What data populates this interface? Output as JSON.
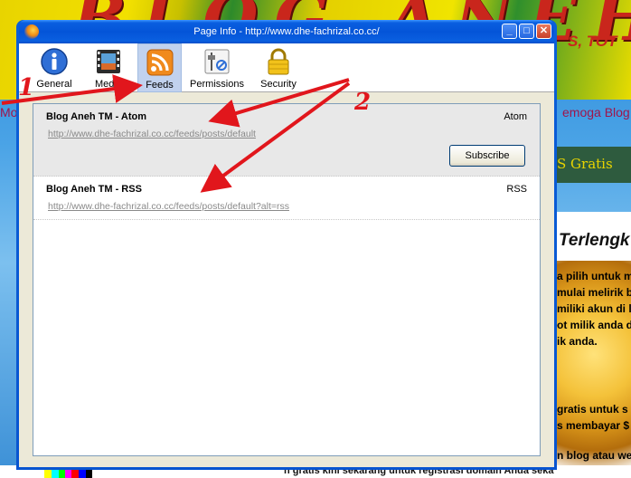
{
  "background": {
    "logo_left": "BLOG",
    "logo_right": "ANEH",
    "tagline": "S, TOT",
    "marquee_left": "Mo",
    "marquee_right": "emoga Blog",
    "nav_item": "S Gratis",
    "post_title": "Terlengk",
    "post_lines": [
      "a pilih untuk m",
      "mulai melirik b",
      "miliki akun di l",
      "ot milik anda d",
      "ik anda.",
      "gratis untuk s",
      "s membayar $",
      "n blog atau we"
    ],
    "bottom_text": "n gratis kini sekarang untuk registrasi domain Anda seka"
  },
  "window": {
    "title": "Page Info - http://www.dhe-fachrizal.co.cc/",
    "buttons": {
      "minimize": "_",
      "maximize": "□",
      "close": "✕"
    }
  },
  "toolbar": {
    "tabs": [
      {
        "label": "General",
        "icon": "info-icon"
      },
      {
        "label": "Media",
        "icon": "media-icon"
      },
      {
        "label": "Feeds",
        "icon": "rss-feed-icon",
        "selected": true
      },
      {
        "label": "Permissions",
        "icon": "permissions-icon"
      },
      {
        "label": "Security",
        "icon": "lock-icon"
      }
    ]
  },
  "feeds": [
    {
      "title": "Blog Aneh TM - Atom",
      "type": "Atom",
      "url": "http://www.dhe-fachrizal.co.cc/feeds/posts/default"
    },
    {
      "title": "Blog Aneh TM - RSS",
      "type": "RSS",
      "url": "http://www.dhe-fachrizal.co.cc/feeds/posts/default?alt=rss"
    }
  ],
  "subscribe_label": "Subscribe",
  "annotations": {
    "one": "1",
    "two": "2"
  },
  "colors": {
    "accent": "#0a5fe0",
    "annotation": "#e1161c",
    "selected_tab": "#c1d2ee"
  }
}
